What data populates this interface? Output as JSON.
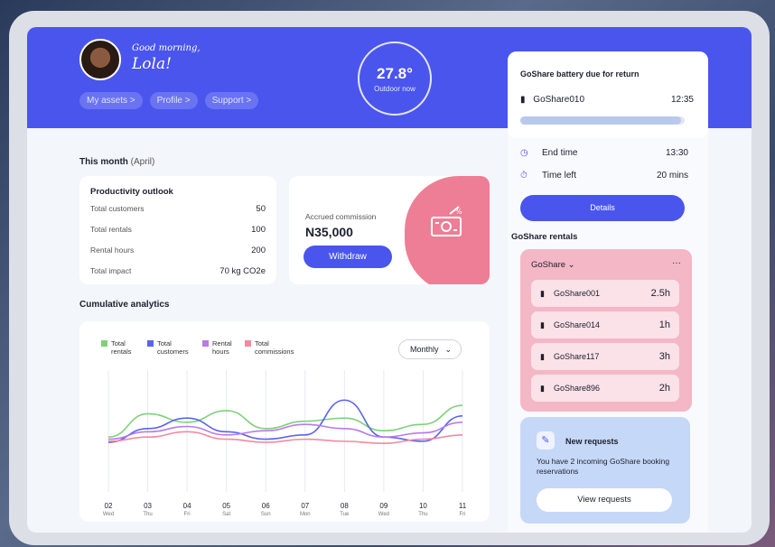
{
  "header": {
    "greeting": "Good morning,",
    "name": "Lola!",
    "links": [
      "My assets >",
      "Profile >",
      "Support >"
    ],
    "temperature": "27.8°",
    "temperature_label": "Outdoor now"
  },
  "this_month": {
    "title": "This month",
    "month": "(April)"
  },
  "productivity": {
    "title": "Productivity outlook",
    "rows": [
      {
        "label": "Total customers",
        "value": "50"
      },
      {
        "label": "Total rentals",
        "value": "100"
      },
      {
        "label": "Rental hours",
        "value": "200"
      },
      {
        "label": "Total impact",
        "value": "70 kg CO2e"
      }
    ]
  },
  "commission": {
    "label": "Accrued commission",
    "amount": "N35,000",
    "button": "Withdraw",
    "icon": "money-icon"
  },
  "analytics": {
    "title": "Cumulative analytics",
    "period": "Monthly"
  },
  "chart_data": {
    "type": "line",
    "categories": [
      "02 Wed",
      "03 Thu",
      "04 Fri",
      "05 Sat",
      "06 Sun",
      "07 Mon",
      "08 Tue",
      "09 Wed",
      "10 Thu",
      "11 Fri"
    ],
    "x_labels": [
      {
        "num": "02",
        "day": "Wed"
      },
      {
        "num": "03",
        "day": "Thu"
      },
      {
        "num": "04",
        "day": "Fri"
      },
      {
        "num": "05",
        "day": "Sat"
      },
      {
        "num": "06",
        "day": "Sun"
      },
      {
        "num": "07",
        "day": "Mon"
      },
      {
        "num": "08",
        "day": "Tue"
      },
      {
        "num": "09",
        "day": "Wed"
      },
      {
        "num": "10",
        "day": "Thu"
      },
      {
        "num": "11",
        "day": "Fri"
      }
    ],
    "series": [
      {
        "name": "Total rentals",
        "color": "#7fd07a",
        "values": [
          40,
          62,
          54,
          65,
          48,
          55,
          58,
          46,
          52,
          70
        ]
      },
      {
        "name": "Total customers",
        "color": "#5a63f0",
        "values": [
          35,
          48,
          58,
          45,
          38,
          42,
          75,
          40,
          36,
          60
        ]
      },
      {
        "name": "Rental hours",
        "color": "#b77ae8",
        "values": [
          38,
          45,
          50,
          42,
          46,
          52,
          48,
          40,
          44,
          54
        ]
      },
      {
        "name": "Total commissions",
        "color": "#f28aa0",
        "values": [
          36,
          40,
          45,
          38,
          35,
          38,
          36,
          34,
          38,
          42
        ]
      }
    ],
    "ylim": [
      0,
      100
    ],
    "legend_position": "top-left",
    "grid": "vertical"
  },
  "battery": {
    "title": "GoShare battery due for return",
    "device": "GoShare010",
    "time": "12:35",
    "progress": 0.98
  },
  "timing": [
    {
      "icon": "clock-icon",
      "label": "End time",
      "value": "13:30"
    },
    {
      "icon": "stopwatch-icon",
      "label": "Time left",
      "value": "20 mins"
    }
  ],
  "details_button": "Details",
  "rentals": {
    "title": "GoShare rentals",
    "filter": "GoShare",
    "more": "···",
    "items": [
      {
        "name": "GoShare001",
        "hours": "2.5h"
      },
      {
        "name": "GoShare014",
        "hours": "1h"
      },
      {
        "name": "GoShare117",
        "hours": "3h"
      },
      {
        "name": "GoShare896",
        "hours": "2h"
      }
    ]
  },
  "requests": {
    "title": "New requests",
    "text": "You have 2 incoming GoShare booking reservations",
    "button": "View requests"
  }
}
